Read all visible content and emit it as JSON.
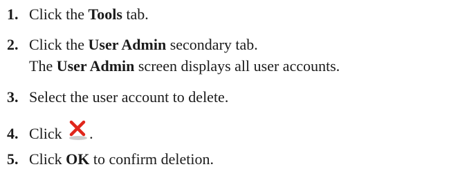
{
  "steps": [
    {
      "num": "1.",
      "pre": "Click the ",
      "bold": "Tools",
      "post": " tab."
    },
    {
      "num": "2.",
      "pre": "Click the ",
      "bold": "User Admin",
      "post": " secondary tab.",
      "note": {
        "pre": "The ",
        "bold": "User Admin",
        "post": " screen displays all user accounts."
      }
    },
    {
      "num": "3.",
      "text": "Select the user account to delete."
    },
    {
      "num": "4.",
      "pre": "Click ",
      "post": ".",
      "icon": "delete-x-icon"
    },
    {
      "num": "5.",
      "pre": "Click ",
      "bold": "OK",
      "post": " to confirm deletion."
    }
  ],
  "colors": {
    "text": "#1a1a1a",
    "icon_red": "#e0261b",
    "icon_shadow": "#b8b8b8"
  }
}
